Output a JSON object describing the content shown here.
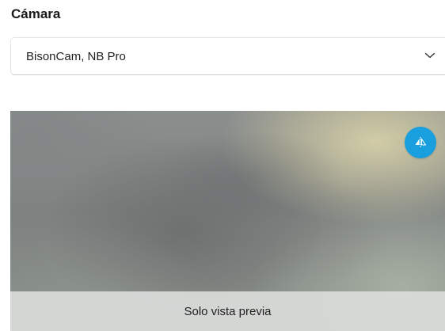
{
  "camera_section": {
    "title": "Cámara",
    "selected_camera": "BisonCam, NB Pro"
  },
  "preview": {
    "status_text": "Solo vista previa",
    "flip_button_icon": "flip-icon",
    "flip_button_color": "#1a9fde"
  }
}
